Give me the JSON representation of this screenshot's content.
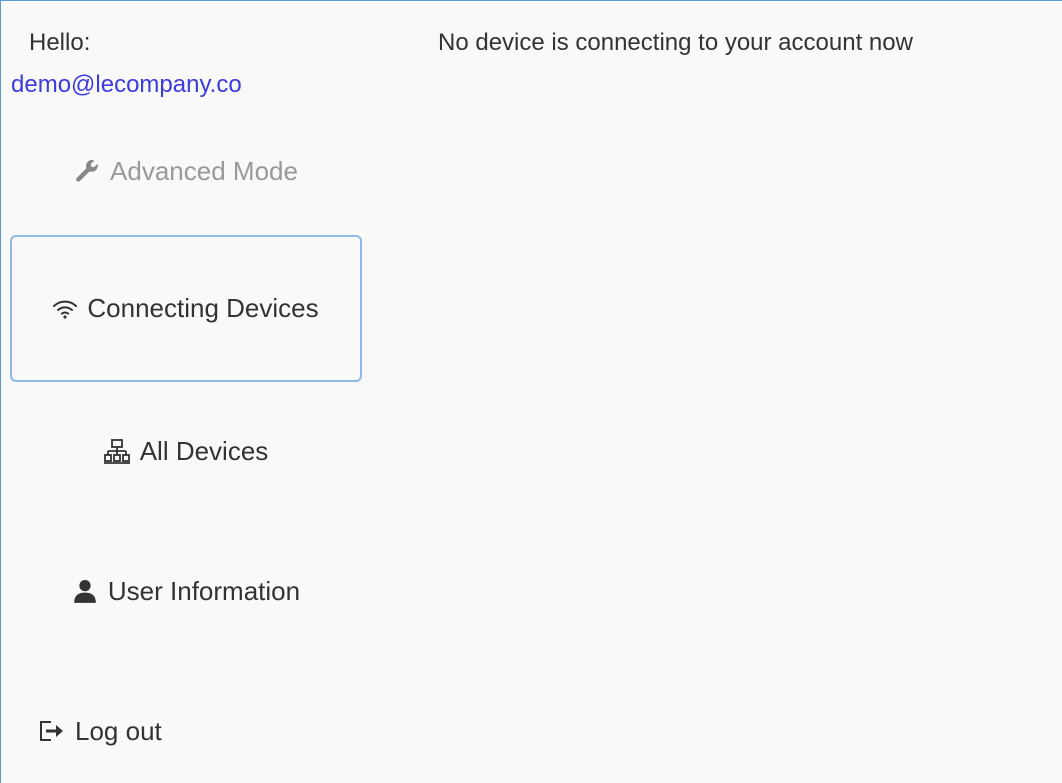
{
  "header": {
    "greeting": "Hello:",
    "email": "demo@lecompany.co",
    "status_message": "No device is connecting to your account now"
  },
  "nav": {
    "advanced_mode": {
      "label": "Advanced Mode",
      "icon": "wrench-icon"
    },
    "connecting_devices": {
      "label": "Connecting Devices",
      "icon": "wifi-icon",
      "active": true
    },
    "all_devices": {
      "label": "All Devices",
      "icon": "network-icon"
    },
    "user_information": {
      "label": "User Information",
      "icon": "user-icon"
    },
    "log_out": {
      "label": "Log out",
      "icon": "logout-icon"
    }
  },
  "colors": {
    "link": "#3c3cdc",
    "active_border": "#8fb8e8",
    "muted": "#999999",
    "text": "#333333",
    "background": "#f9f9f9"
  }
}
